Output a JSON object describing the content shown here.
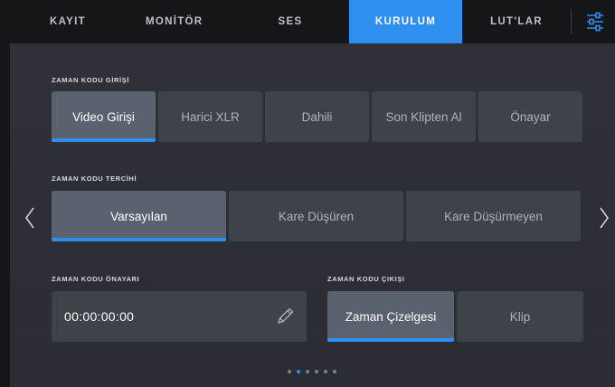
{
  "tabs": [
    {
      "label": "KAYIT"
    },
    {
      "label": "MONİTÖR"
    },
    {
      "label": "SES"
    },
    {
      "label": "KURULUM"
    },
    {
      "label": "LUT'LAR"
    }
  ],
  "timecode_input": {
    "label": "ZAMAN KODU GİRİŞİ",
    "options": [
      "Video Girişi",
      "Harici XLR",
      "Dahili",
      "Son Klipten Al",
      "Önayar"
    ],
    "selected": "Video Girişi"
  },
  "timecode_preference": {
    "label": "ZAMAN KODU TERCİHİ",
    "options": [
      "Varsayılan",
      "Kare Düşüren",
      "Kare Düşürmeyen"
    ],
    "selected": "Varsayılan"
  },
  "timecode_preset": {
    "label": "ZAMAN KODU ÖNAYARI",
    "value": "00:00:00:00"
  },
  "timecode_output": {
    "label": "ZAMAN KODU ÇIKIŞI",
    "options": [
      "Zaman Çizelgesi",
      "Klip"
    ],
    "selected": "Zaman Çizelgesi"
  },
  "pagination": {
    "total": 6,
    "current": 1
  },
  "colors": {
    "accent": "#2f8ff0",
    "tabbar": "#141619",
    "background": "#2b2f35"
  },
  "icons": [
    "settings-sliders-icon",
    "chevron-left-icon",
    "chevron-right-icon",
    "pencil-icon"
  ]
}
